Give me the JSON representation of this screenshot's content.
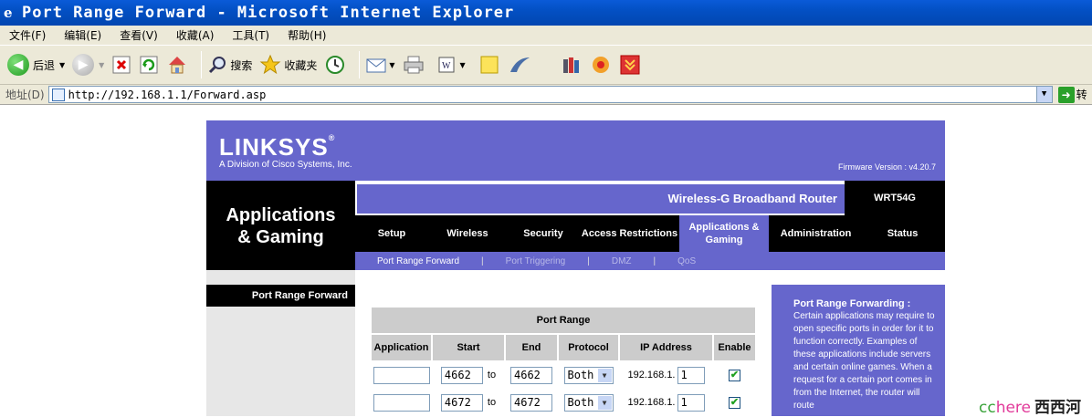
{
  "window": {
    "title": "Port Range Forward - Microsoft Internet Explorer",
    "icon": "ie-icon"
  },
  "menu": [
    "文件(F)",
    "编辑(E)",
    "查看(V)",
    "收藏(A)",
    "工具(T)",
    "帮助(H)"
  ],
  "toolbar": {
    "back": "后退",
    "search": "搜索",
    "favorites": "收藏夹"
  },
  "address": {
    "label": "地址(D)",
    "url": "http://192.168.1.1/Forward.asp",
    "go": "转"
  },
  "router": {
    "logo": "LINKSYS",
    "logo_reg": "®",
    "logo_sub": "A Division of Cisco Systems, Inc.",
    "firmware": "Firmware Version : v4.20.7",
    "product": "Wireless-G Broadband Router",
    "model": "WRT54G",
    "section_title_1": "Applications",
    "section_title_2": "& Gaming",
    "nav": [
      {
        "label": "Setup"
      },
      {
        "label": "Wireless"
      },
      {
        "label": "Security"
      },
      {
        "label": "Access Restrictions"
      },
      {
        "label": "Applications & Gaming",
        "active": true
      },
      {
        "label": "Administration"
      },
      {
        "label": "Status"
      }
    ],
    "subnav": [
      "Port Range Forward",
      "Port Triggering",
      "DMZ",
      "QoS"
    ],
    "side_title": "Port Range Forward",
    "table": {
      "group_header": "Port Range",
      "headers": [
        "Application",
        "Start",
        "End",
        "Protocol",
        "IP Address",
        "Enable"
      ],
      "rows": [
        {
          "application": "",
          "start": "4662",
          "to": "to",
          "end": "4662",
          "protocol": "Both",
          "ip_prefix": "192.168.1.",
          "ip_last": "1",
          "enabled": true
        },
        {
          "application": "",
          "start": "4672",
          "to": "to",
          "end": "4672",
          "protocol": "Both",
          "ip_prefix": "192.168.1.",
          "ip_last": "1",
          "enabled": true
        }
      ]
    },
    "help": {
      "title": "Port Range Forwarding :",
      "body": "Certain applications may require to open specific ports in order for it to function correctly. Examples of these applications include servers and certain online games. When a request for a certain port comes in from the Internet, the router will route"
    }
  },
  "watermark": {
    "cc": "cc",
    "here": "here",
    "xxh": "西西河"
  }
}
